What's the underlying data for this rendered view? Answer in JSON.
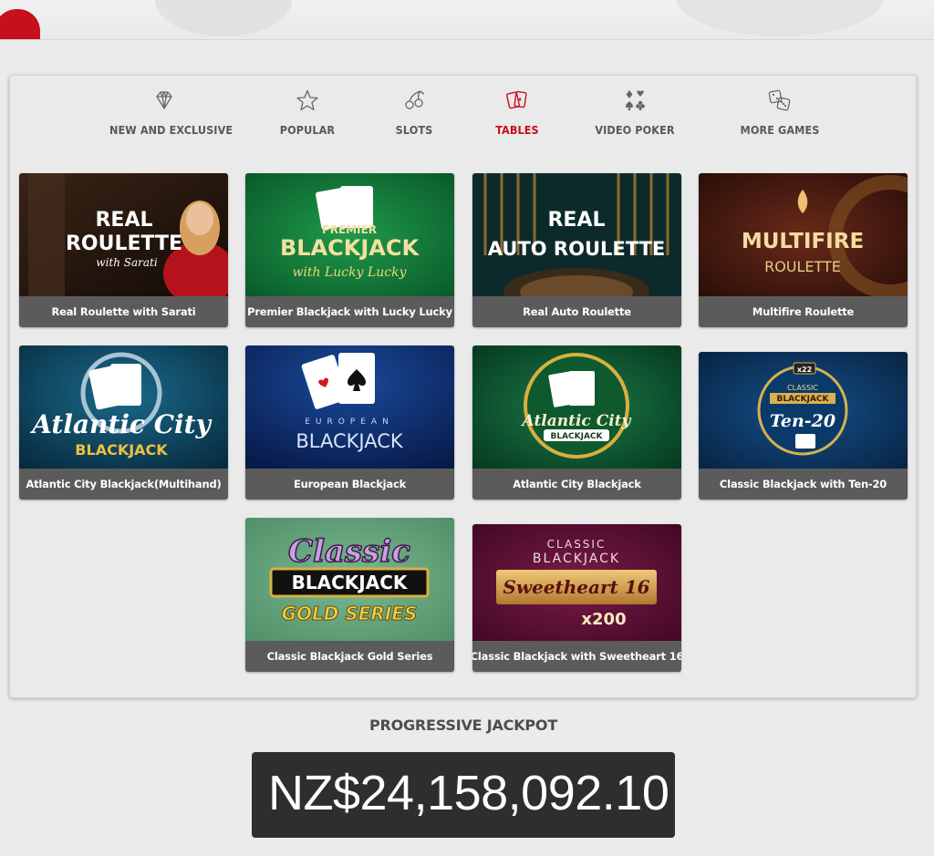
{
  "categories": [
    {
      "label": "NEW AND EXCLUSIVE",
      "icon": "diamond-icon",
      "active": false
    },
    {
      "label": "POPULAR",
      "icon": "star-icon",
      "active": false
    },
    {
      "label": "SLOTS",
      "icon": "cherries-icon",
      "active": false
    },
    {
      "label": "TABLES",
      "icon": "cards-icon",
      "active": true
    },
    {
      "label": "VIDEO POKER",
      "icon": "card-suits-icon",
      "active": false
    },
    {
      "label": "MORE GAMES",
      "icon": "dice-icon",
      "active": false
    }
  ],
  "games": [
    {
      "title": "Real Roulette with Sarati",
      "art_line1": "REAL",
      "art_line2": "ROULETTE",
      "art_line3": "with Sarati"
    },
    {
      "title": "Premier Blackjack with Lucky Lucky",
      "art_line1": "PREMIER",
      "art_line2": "BLACKJACK",
      "art_line3": "with Lucky Lucky"
    },
    {
      "title": "Real Auto Roulette",
      "art_line1": "REAL",
      "art_line2": "AUTO ROULETTE"
    },
    {
      "title": "Multifire Roulette",
      "art_line1": "MULTIFIRE",
      "art_line2": "ROULETTE"
    },
    {
      "title": "Atlantic City Blackjack(Multihand)",
      "art_line1": "Atlantic City",
      "art_line2": "BLACKJACK"
    },
    {
      "title": "European Blackjack",
      "art_line1": "EUROPEAN",
      "art_line2": "BLACKJACK"
    },
    {
      "title": "Atlantic City Blackjack",
      "art_line1": "Atlantic City",
      "art_line2": "BLACKJACK"
    },
    {
      "title": "Classic Blackjack with Ten-20",
      "art_line1": "CLASSIC",
      "art_line2": "BLACKJACK",
      "art_line3": "Ten-20",
      "art_badge": "x22"
    },
    {
      "title": "Classic Blackjack Gold Series",
      "art_line1": "Classic",
      "art_line2": "BLACKJACK",
      "art_line3": "GOLD SERIES"
    },
    {
      "title": "Classic Blackjack with Sweetheart 16",
      "art_line1": "CLASSIC",
      "art_line2": "BLACKJACK",
      "art_line3": "Sweetheart 16",
      "art_badge": "x200"
    }
  ],
  "jackpot": {
    "title": "PROGRESSIVE JACKPOT",
    "value": "NZ$24,158,092.10"
  },
  "colors": {
    "accent": "#c8101c",
    "caption_bg": "#5b5b5b",
    "jackpot_bg": "#2e2e2e"
  }
}
